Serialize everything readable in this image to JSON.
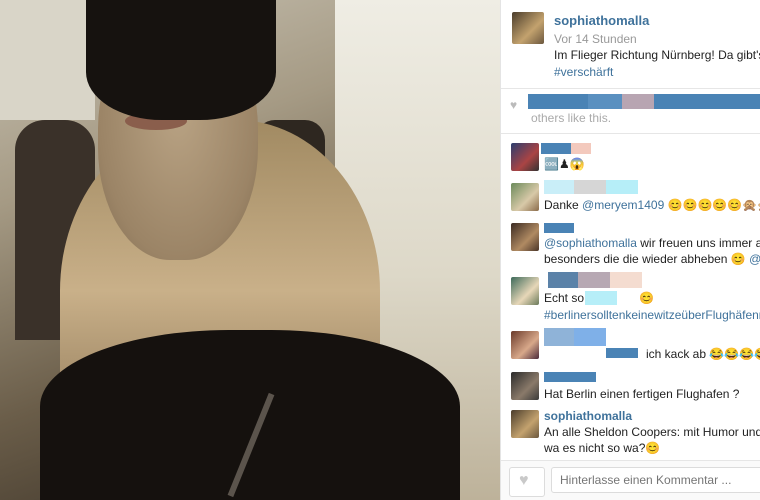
{
  "post": {
    "username": "sophiathomalla",
    "timestamp": "Vor 14 Stunden",
    "caption": "Im Flieger Richtung Nürnberg! Da gibt's n",
    "hashtag": "#verschärft"
  },
  "likes": {
    "icon": "heart-icon",
    "others_text": "others like this."
  },
  "comments": [
    {
      "text": "🆒♟😱"
    },
    {
      "prefix": "Danke ",
      "mention": "@meryem1409",
      "suffix": " 😊😊😊😊😊🙊🙊👆👆"
    },
    {
      "mention": "@sophiathomalla",
      "line1": " wir freuen uns immer auf C",
      "line2": "besonders die die wieder abheben 😊 ",
      "mention2": "@ad_"
    },
    {
      "prefix": "Echt so",
      "emoji": "😊",
      "hashtag": "#berlinersolltenkeinewitzeüberFlughäfenma"
    },
    {
      "text": "ich kack ab 😂😂😂😂 zu"
    },
    {
      "text": "Hat Berlin einen fertigen Flughafen ?"
    },
    {
      "name": "sophiathomalla",
      "line1": "An alle Sheldon Coopers: mit Humor und Iro",
      "line2": "wa es nicht so wa?😊"
    }
  ],
  "footer": {
    "like_icon": "heart-icon",
    "comment_placeholder": "Hinterlasse einen Kommentar ..."
  },
  "colors": {
    "link": "#3f729b",
    "muted": "#999999"
  }
}
